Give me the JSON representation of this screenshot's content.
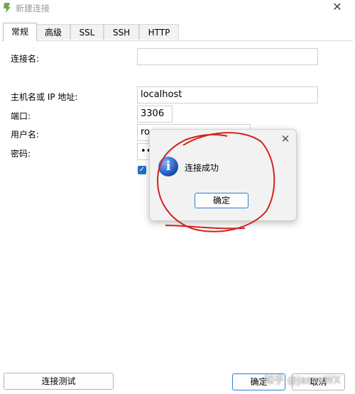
{
  "window": {
    "title": "新建连接"
  },
  "tabs": [
    {
      "label": "常规"
    },
    {
      "label": "高级"
    },
    {
      "label": "SSL"
    },
    {
      "label": "SSH"
    },
    {
      "label": "HTTP"
    }
  ],
  "form": {
    "connection_name_label": "连接名:",
    "connection_name_value": "",
    "host_label": "主机名或 IP 地址:",
    "host_value": "localhost",
    "port_label": "端口:",
    "port_value": "3306",
    "username_label": "用户名:",
    "username_value": "ro",
    "password_label": "密码:",
    "password_value": "••",
    "save_password_checked": true
  },
  "dialog": {
    "message": "连接成功",
    "ok_label": "确定"
  },
  "buttons": {
    "test_label": "连接测试",
    "ok_label": "确定",
    "cancel_label": "取消"
  },
  "watermark": "知乎 @JasonWX",
  "colors": {
    "accent": "#2f7ad6",
    "checkbox": "#1f6fc5",
    "annotation": "#d42020"
  }
}
